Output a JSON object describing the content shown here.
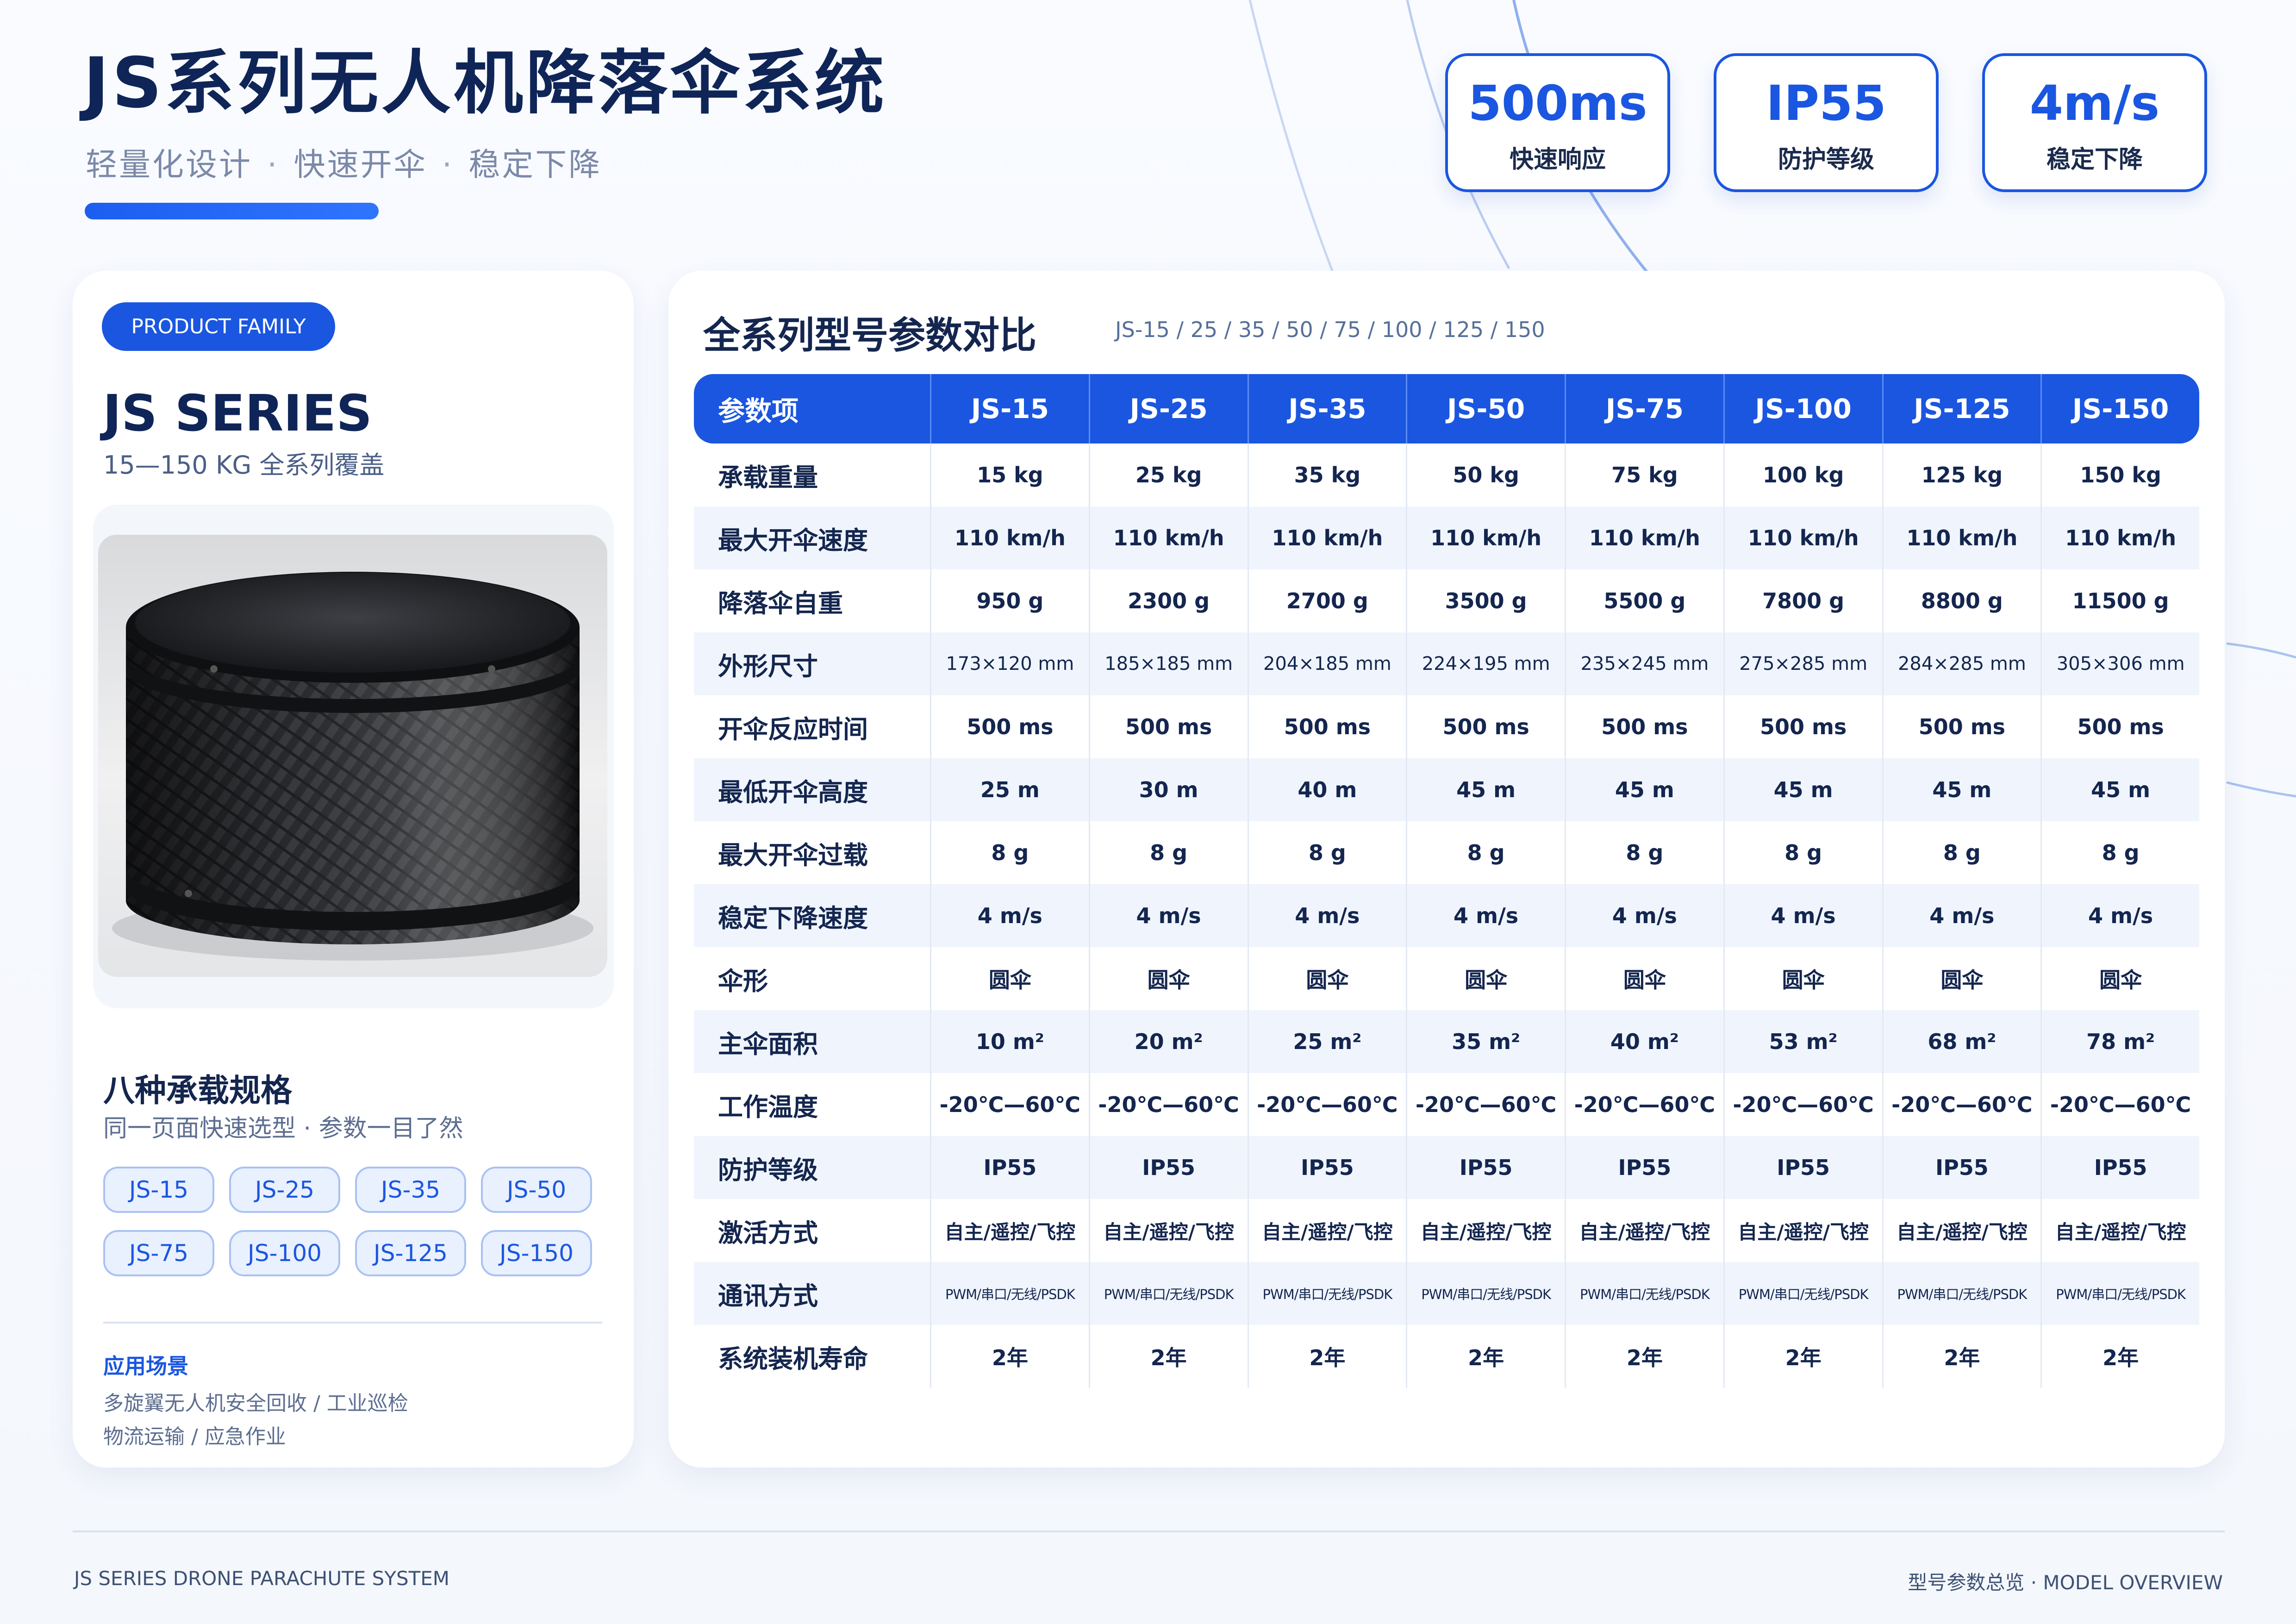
{
  "header": {
    "title": "JS系列无人机降落伞系统",
    "tagline": [
      "轻量化设计",
      "快速开伞",
      "稳定下降"
    ],
    "tagline_sep": "·"
  },
  "stats": [
    {
      "value": "500ms",
      "label": "快速响应"
    },
    {
      "value": "IP55",
      "label": "防护等级"
    },
    {
      "value": "4m/s",
      "label": "稳定下降"
    }
  ],
  "left_card": {
    "pill": "PRODUCT FAMILY",
    "series": "JS SERIES",
    "series_sub": "15—150 KG  全系列覆盖",
    "heading": "八种承载规格",
    "heading_sub": "同一页面快速选型 · 参数一目了然",
    "chips": [
      "JS-15",
      "JS-25",
      "JS-35",
      "JS-50",
      "JS-75",
      "JS-100",
      "JS-125",
      "JS-150"
    ],
    "app_heading": "应用场景",
    "app_lines": [
      "多旋翼无人机安全回收 / 工业巡检",
      "物流运输 / 应急作业"
    ]
  },
  "table": {
    "title": "全系列型号参数对比",
    "subtitle": "JS-15 / 25 / 35 / 50 / 75 / 100 / 125 / 150",
    "header_label": "参数项",
    "models": [
      "JS-15",
      "JS-25",
      "JS-35",
      "JS-50",
      "JS-75",
      "JS-100",
      "JS-125",
      "JS-150"
    ],
    "rows": [
      {
        "label": "承载重量",
        "size": "",
        "values": [
          "15 kg",
          "25 kg",
          "35 kg",
          "50 kg",
          "75 kg",
          "100 kg",
          "125 kg",
          "150 kg"
        ]
      },
      {
        "label": "最大开伞速度",
        "size": "",
        "values": [
          "110 km/h",
          "110 km/h",
          "110 km/h",
          "110 km/h",
          "110 km/h",
          "110 km/h",
          "110 km/h",
          "110 km/h"
        ]
      },
      {
        "label": "降落伞自重",
        "size": "",
        "values": [
          "950 g",
          "2300 g",
          "2700 g",
          "3500 g",
          "5500 g",
          "7800 g",
          "8800 g",
          "11500 g"
        ]
      },
      {
        "label": "外形尺寸",
        "size": "sm",
        "values": [
          "173×120 mm",
          "185×185 mm",
          "204×185 mm",
          "224×195 mm",
          "235×245 mm",
          "275×285 mm",
          "284×285 mm",
          "305×306 mm"
        ]
      },
      {
        "label": "开伞反应时间",
        "size": "",
        "values": [
          "500 ms",
          "500 ms",
          "500 ms",
          "500 ms",
          "500 ms",
          "500 ms",
          "500 ms",
          "500 ms"
        ]
      },
      {
        "label": "最低开伞高度",
        "size": "",
        "values": [
          "25 m",
          "30 m",
          "40 m",
          "45 m",
          "45 m",
          "45 m",
          "45 m",
          "45 m"
        ]
      },
      {
        "label": "最大开伞过载",
        "size": "",
        "values": [
          "8 g",
          "8 g",
          "8 g",
          "8 g",
          "8 g",
          "8 g",
          "8 g",
          "8 g"
        ]
      },
      {
        "label": "稳定下降速度",
        "size": "",
        "values": [
          "4 m/s",
          "4 m/s",
          "4 m/s",
          "4 m/s",
          "4 m/s",
          "4 m/s",
          "4 m/s",
          "4 m/s"
        ]
      },
      {
        "label": "伞形",
        "size": "",
        "values": [
          "圆伞",
          "圆伞",
          "圆伞",
          "圆伞",
          "圆伞",
          "圆伞",
          "圆伞",
          "圆伞"
        ]
      },
      {
        "label": "主伞面积",
        "size": "",
        "values": [
          "10 m²",
          "20 m²",
          "25 m²",
          "35 m²",
          "40 m²",
          "53 m²",
          "68 m²",
          "78 m²"
        ]
      },
      {
        "label": "工作温度",
        "size": "",
        "values": [
          "-20℃—60℃",
          "-20℃—60℃",
          "-20℃—60℃",
          "-20℃—60℃",
          "-20℃—60℃",
          "-20℃—60℃",
          "-20℃—60℃",
          "-20℃—60℃"
        ]
      },
      {
        "label": "防护等级",
        "size": "",
        "values": [
          "IP55",
          "IP55",
          "IP55",
          "IP55",
          "IP55",
          "IP55",
          "IP55",
          "IP55"
        ]
      },
      {
        "label": "激活方式",
        "size": "md",
        "values": [
          "自主/遥控/飞控",
          "自主/遥控/飞控",
          "自主/遥控/飞控",
          "自主/遥控/飞控",
          "自主/遥控/飞控",
          "自主/遥控/飞控",
          "自主/遥控/飞控",
          "自主/遥控/飞控"
        ]
      },
      {
        "label": "通讯方式",
        "size": "xs",
        "values": [
          "PWM/串口/无线/PSDK",
          "PWM/串口/无线/PSDK",
          "PWM/串口/无线/PSDK",
          "PWM/串口/无线/PSDK",
          "PWM/串口/无线/PSDK",
          "PWM/串口/无线/PSDK",
          "PWM/串口/无线/PSDK",
          "PWM/串口/无线/PSDK"
        ]
      },
      {
        "label": "系统装机寿命",
        "size": "",
        "values": [
          "2年",
          "2年",
          "2年",
          "2年",
          "2年",
          "2年",
          "2年",
          "2年"
        ]
      }
    ]
  },
  "footer": {
    "left": "JS SERIES DRONE PARACHUTE SYSTEM",
    "right": "型号参数总览  ·  MODEL OVERVIEW"
  },
  "colors": {
    "brand_blue": "#1a56e0",
    "navy": "#0f2557",
    "muted": "#7b89a8"
  }
}
